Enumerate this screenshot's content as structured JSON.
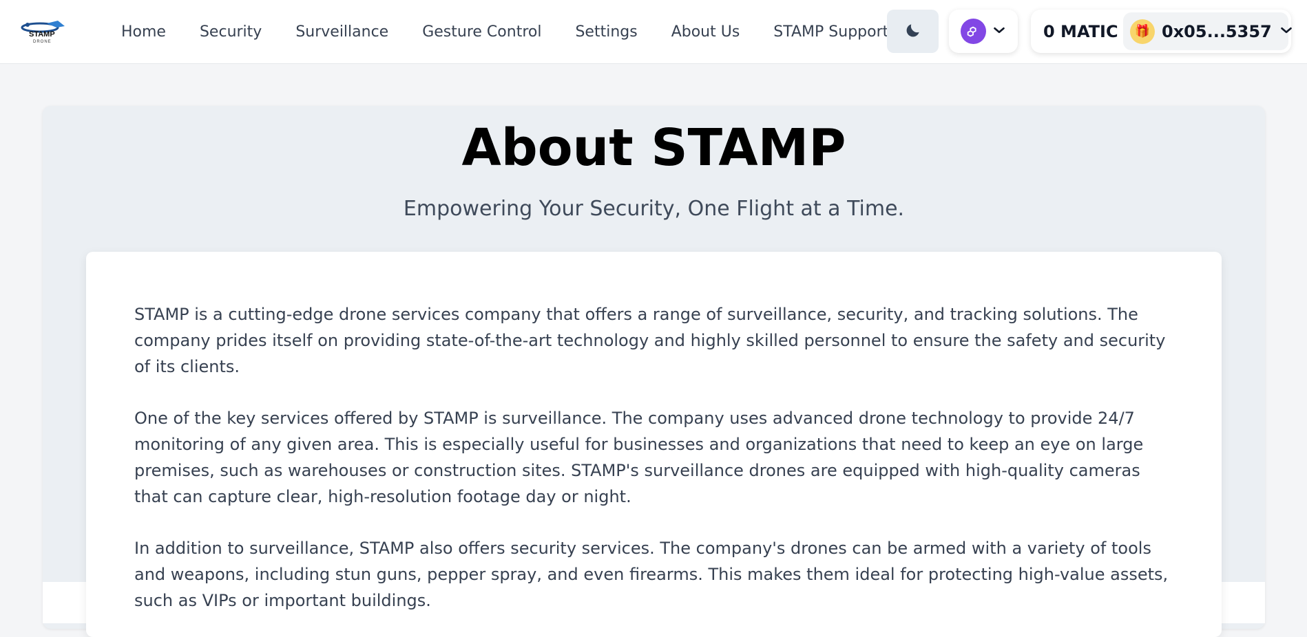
{
  "header": {
    "logo_text": "STAMP",
    "logo_subtext": "DRONE",
    "nav": [
      {
        "label": "Home"
      },
      {
        "label": "Security"
      },
      {
        "label": "Surveillance"
      },
      {
        "label": "Gesture Control"
      },
      {
        "label": "Settings"
      },
      {
        "label": "About Us"
      },
      {
        "label": "STAMP Support"
      }
    ],
    "theme_icon": "moon-icon",
    "network_icon": "polygon-icon",
    "balance": "0 MATIC",
    "account_address": "0x05...5357",
    "account_avatar": "🎁"
  },
  "main": {
    "title": "About STAMP",
    "subtitle": "Empowering Your Security, One Flight at a Time.",
    "paragraphs": [
      "STAMP is a cutting-edge drone services company that offers a range of surveillance, security, and tracking solutions. The company prides itself on providing state-of-the-art technology and highly skilled personnel to ensure the safety and security of its clients.",
      "One of the key services offered by STAMP is surveillance. The company uses advanced drone technology to provide 24/7 monitoring of any given area. This is especially useful for businesses and organizations that need to keep an eye on large premises, such as warehouses or construction sites. STAMP's surveillance drones are equipped with high-quality cameras that can capture clear, high-resolution footage day or night.",
      "In addition to surveillance, STAMP also offers security services. The company's drones can be armed with a variety of tools and weapons, including stun guns, pepper spray, and even firearms. This makes them ideal for protecting high-value assets, such as VIPs or important buildings."
    ]
  },
  "colors": {
    "accent_polygon": "#8247e5",
    "card_background": "#ebeff3",
    "page_background": "#f4f5f7"
  }
}
